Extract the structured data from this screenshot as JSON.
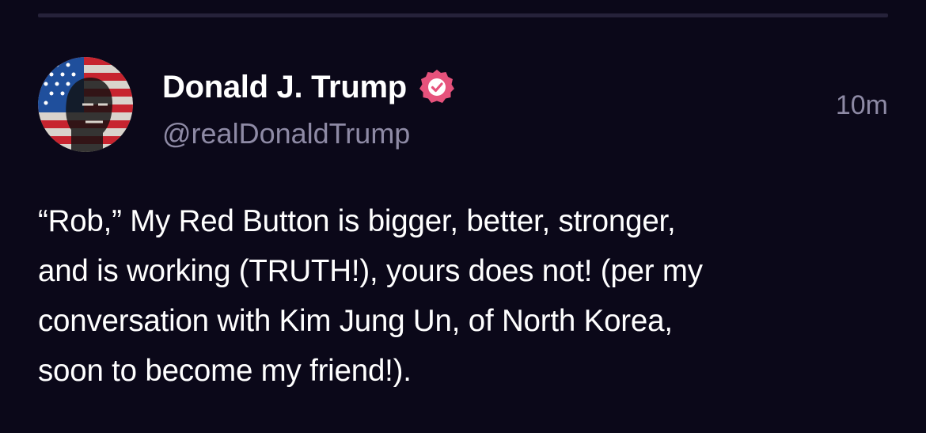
{
  "post": {
    "author": {
      "display_name": "Donald J. Trump",
      "handle": "@realDonaldTrump",
      "avatar_icon": "flag-portrait-avatar",
      "verified_icon": "verified-badge-icon"
    },
    "timestamp": "10m",
    "text": "“Rob,” My Red Button is bigger, better, stronger,\nand is working (TRUTH!), yours does not! (per my\nconversation with Kim Jung Un, of North Korea,\nsoon to become my friend!)."
  },
  "colors": {
    "background": "#0b0819",
    "divider": "#26223a",
    "primary_text": "#ffffff",
    "secondary_text": "#8e8aa5",
    "verified_badge": "#e6527c"
  }
}
